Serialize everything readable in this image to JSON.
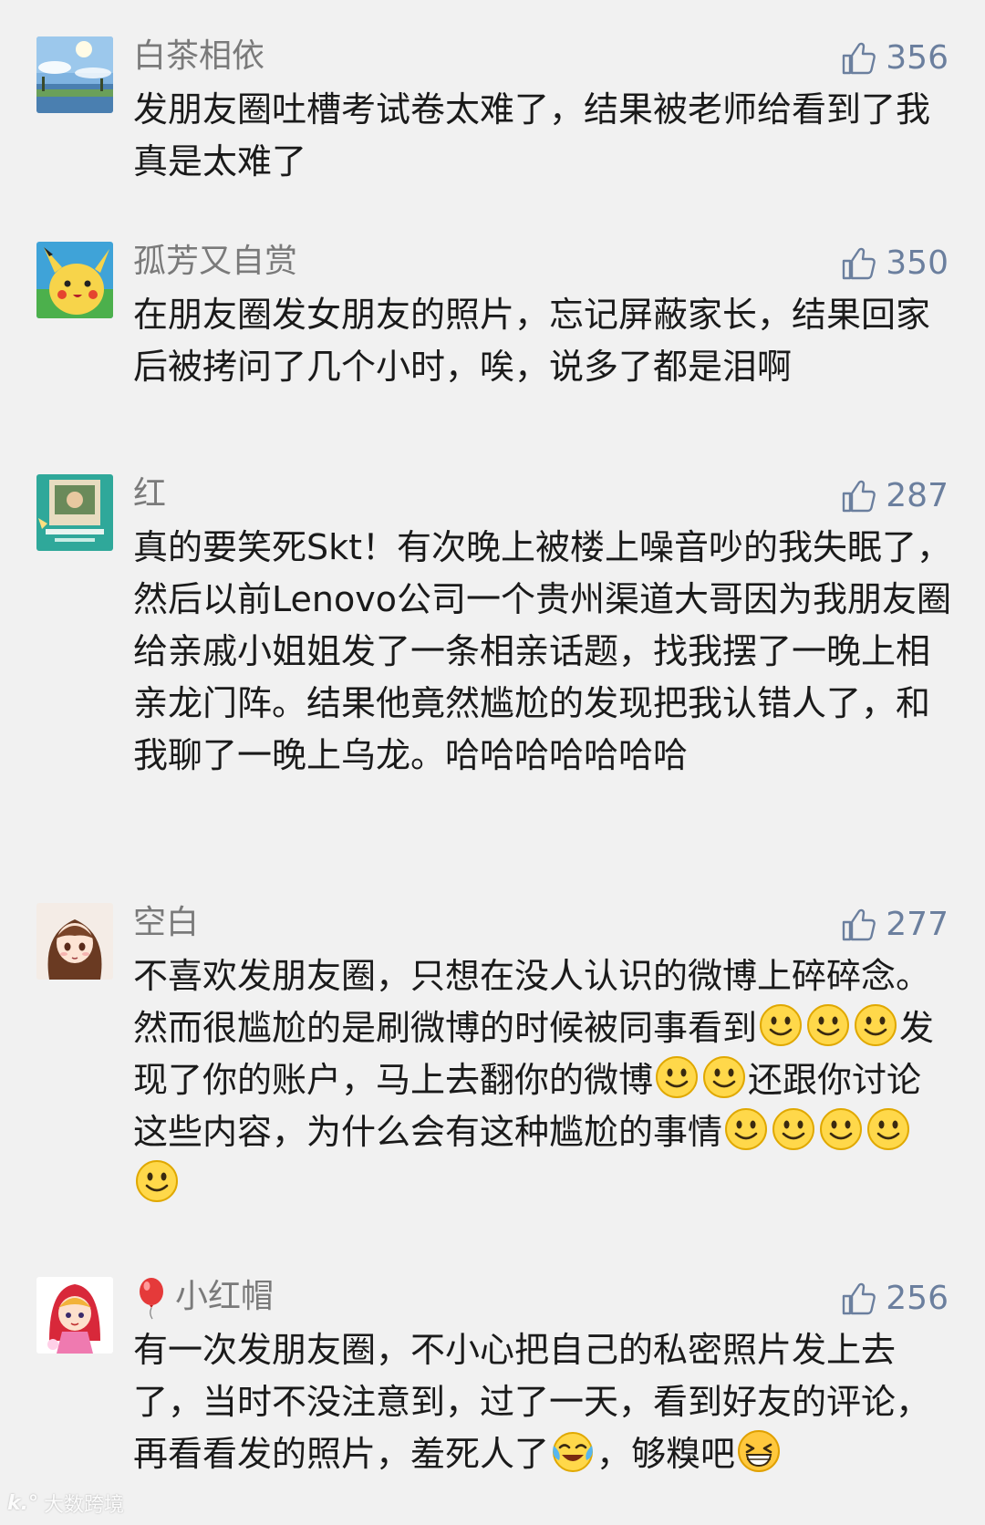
{
  "colors": {
    "background": "#f1f1f1",
    "username": "#7a7a7a",
    "like": "#6b7f9e",
    "text": "#1a1a1a"
  },
  "comments": [
    {
      "username": "白茶相依",
      "likes": "356",
      "avatar_icon": "sky-landscape-avatar",
      "segments": [
        "发朋友圈吐槽考试卷太难了，结果被老师给看到了我真是太难了"
      ]
    },
    {
      "username": "孤芳又自赏",
      "likes": "350",
      "avatar_icon": "pikachu-avatar",
      "segments": [
        "在朋友圈发女朋友的照片，忘记屏蔽家长，结果回家后被拷问了几个小时，唉，说多了都是泪啊"
      ]
    },
    {
      "username": "红",
      "likes": "287",
      "avatar_icon": "poster-avatar",
      "segments": [
        "真的要笑死Skt！有次晚上被楼上噪音吵的我失眠了，然后以前Lenovo公司一个贵州渠道大哥因为我朋友圈给亲戚小姐姐发了一条相亲话题，找我摆了一晚上相亲龙门阵。结果他竟然尴尬的发现把我认错人了，和我聊了一晚上乌龙。哈哈哈哈哈哈哈"
      ]
    },
    {
      "username": "空白",
      "likes": "277",
      "avatar_icon": "anime-girl-avatar",
      "segments": [
        "不喜欢发朋友圈，只想在没人认识的微博上碎碎念。然而很尴尬的是刷微博的时候被同事看到",
        "发现了你的账户，马上去翻你的微博",
        "还跟你讨论这些内容，为什么会有这种尴尬的事情"
      ]
    },
    {
      "username": "小红帽",
      "likes": "256",
      "avatar_icon": "red-riding-hood-avatar",
      "prefix_icon": "balloon-icon",
      "segments": [
        "有一次发朋友圈，不小心把自己的私密照片发上去了，当时不没注意到，过了一天，看到好友的评论，再看看发的照片，羞死人了",
        "，够糗吧"
      ]
    }
  ],
  "watermark": {
    "logo": "k.°",
    "text": "大数跨境"
  }
}
